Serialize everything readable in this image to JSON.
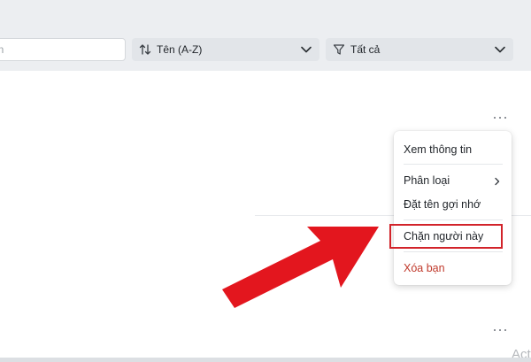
{
  "toolbar": {
    "search": {
      "placeholder": "ạn"
    },
    "sort": {
      "label": "Tên (A-Z)",
      "icon": "sort-icon"
    },
    "filter": {
      "label": "Tất cả",
      "icon": "filter-icon"
    }
  },
  "context_menu": {
    "items": [
      {
        "label": "Xem thông tin"
      },
      {
        "label": "Phân loại",
        "has_submenu": true
      },
      {
        "label": "Đặt tên gợi nhớ"
      },
      {
        "label": "Chặn người này",
        "highlighted": true
      },
      {
        "label": "Xóa bạn",
        "danger": true
      }
    ]
  },
  "annotation": {
    "arrow_color": "#e3161e",
    "highlight_color": "#d2232a"
  },
  "watermark": "Act",
  "colors": {
    "danger_text": "#c0392b",
    "topbar_bg": "#eceef1"
  }
}
